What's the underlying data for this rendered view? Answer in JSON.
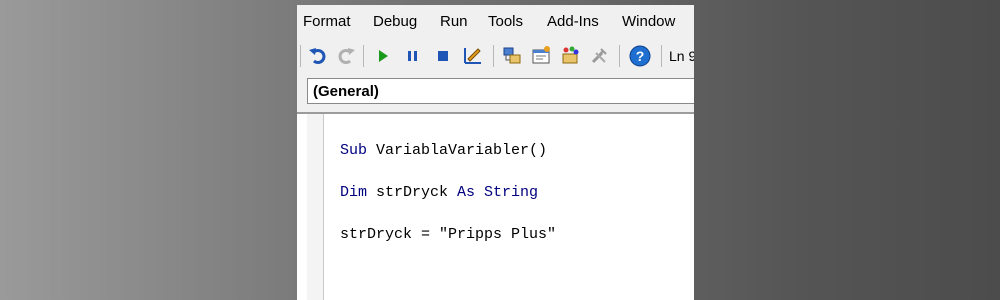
{
  "menu": {
    "items": [
      {
        "label": "Format",
        "name": "menu-format"
      },
      {
        "label": "Debug",
        "name": "menu-debug"
      },
      {
        "label": "Run",
        "name": "menu-run"
      },
      {
        "label": "Tools",
        "name": "menu-tools"
      },
      {
        "label": "Add-Ins",
        "name": "menu-add-ins"
      },
      {
        "label": "Window",
        "name": "menu-window"
      }
    ]
  },
  "toolbar": {
    "buttons": [
      "undo-icon",
      "redo-icon",
      "run-icon",
      "break-icon",
      "reset-icon",
      "design-mode-icon",
      "project-explorer-icon",
      "properties-window-icon",
      "object-browser-icon",
      "toolbox-icon",
      "help-icon"
    ],
    "position_label": "Ln 9"
  },
  "object_combo": {
    "value": "(General)"
  },
  "code": {
    "line1": {
      "keyword": "Sub",
      "rest": " VariablaVariabler()"
    },
    "line2": {
      "kw1": "Dim",
      "mid": " strDryck ",
      "kw2": "As String"
    },
    "line3": {
      "text": "strDryck = \"Pripps Plus\""
    }
  },
  "colors": {
    "keyword": "#00007f",
    "background_left": "#9a9a9a",
    "background_right": "#4c4c4c",
    "help_blue": "#1f6fd1",
    "run_green": "#1a9a1a"
  }
}
